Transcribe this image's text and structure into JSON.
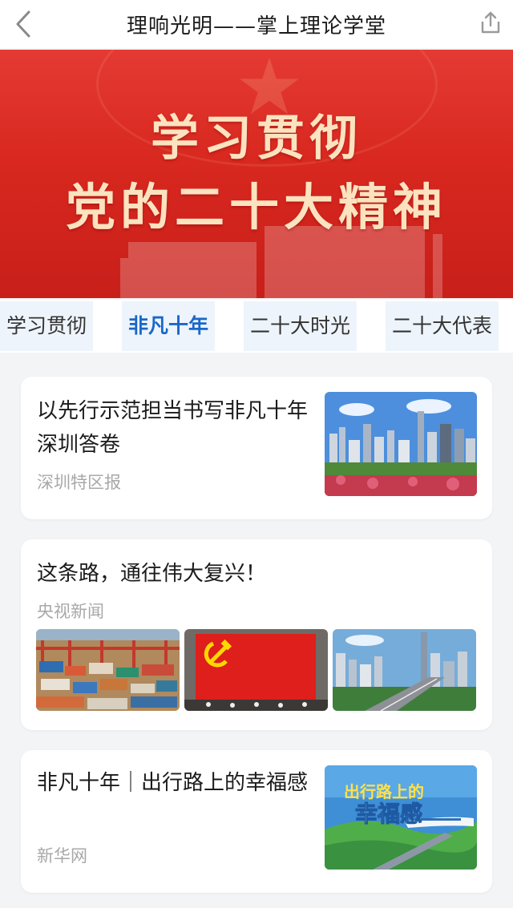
{
  "header": {
    "title": "理响光明——掌上理论学堂",
    "back_icon": "chevron-left-icon",
    "share_icon": "share-icon"
  },
  "banner": {
    "line1": "学习贯彻",
    "line2": "党的二十大精神"
  },
  "tabs": [
    {
      "label": "学习贯彻"
    },
    {
      "label": "非凡十年",
      "active": true
    },
    {
      "label": "二十大时光"
    },
    {
      "label": "二十大代表"
    }
  ],
  "articles": [
    {
      "title": "以先行示范担当书写非凡十年深圳答卷",
      "source": "深圳特区报"
    },
    {
      "title": "这条路，通往伟大复兴！",
      "source": "央视新闻"
    },
    {
      "title": "非凡十年｜出行路上的幸福感",
      "source": "新华网",
      "thumb_text_line1": "出行路上的",
      "thumb_text_line2": "幸福感"
    }
  ],
  "colors": {
    "accent_blue": "#1a67c9",
    "banner_red": "#d8281f",
    "banner_text": "#fbe3c0"
  }
}
